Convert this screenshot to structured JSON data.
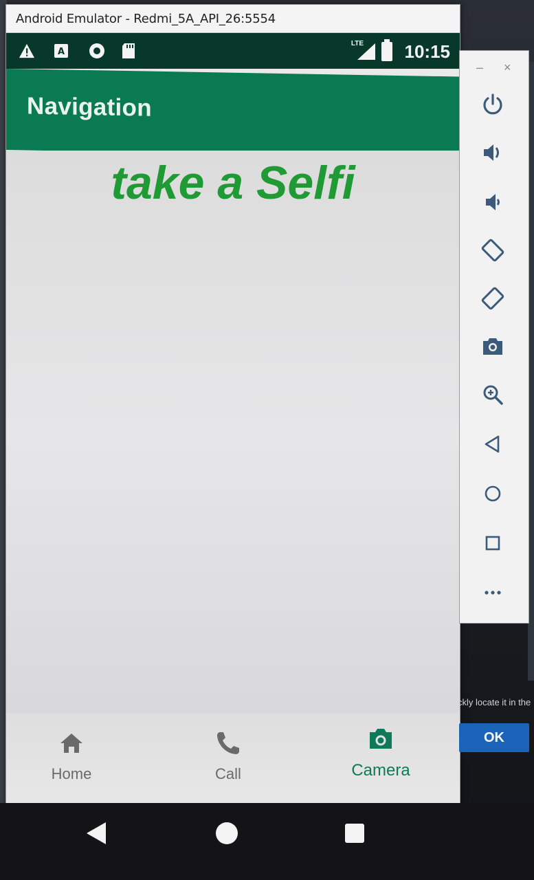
{
  "window": {
    "title": "Android Emulator - Redmi_5A_API_26:5554"
  },
  "status_bar": {
    "time": "10:15",
    "network": "LTE",
    "icons": [
      "warning-icon",
      "app-notification-icon",
      "record-icon",
      "sd-card-icon"
    ]
  },
  "toolbar": {
    "title": "Navigation"
  },
  "content": {
    "headline": "take a Selfi"
  },
  "bottom_nav": {
    "items": [
      {
        "label": "Home",
        "icon": "home-icon"
      },
      {
        "label": "Call",
        "icon": "phone-icon"
      },
      {
        "label": "Camera",
        "icon": "camera-icon",
        "active": true
      }
    ]
  },
  "side_panel": {
    "buttons": [
      "power-icon",
      "volume-up-icon",
      "volume-down-icon",
      "rotate-left-icon",
      "rotate-right-icon",
      "screenshot-camera-icon",
      "zoom-icon",
      "back-icon",
      "home-circle-icon",
      "overview-square-icon",
      "more-icon"
    ],
    "minimize": "–",
    "close": "×"
  },
  "behind_dialog": {
    "text": "ckly locate it in the",
    "ok_label": "OK"
  },
  "colors": {
    "status_bar": "#08382a",
    "toolbar": "#0a7a53",
    "headline": "#1f9a34",
    "active_nav": "#0f7a5a",
    "ok_button": "#1a63b8"
  }
}
